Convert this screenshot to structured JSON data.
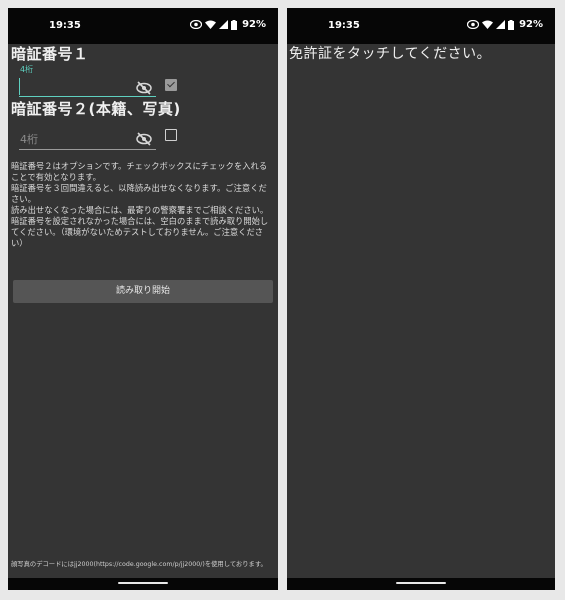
{
  "status_bar": {
    "time": "19:35",
    "battery": "92%"
  },
  "left_screen": {
    "pin1": {
      "heading": "暗証番号１",
      "floating_label": "4桁",
      "value": "",
      "checkbox_checked": true
    },
    "pin2": {
      "heading": "暗証番号２(本籍、写真)",
      "placeholder": "4桁",
      "value": "",
      "checkbox_checked": false
    },
    "notes": [
      "暗証番号２はオプションです。チェックボックスにチェックを入れることで有効となります。",
      "暗証番号を３回間違えると、以降読み出せなくなります。ご注意ください。",
      "読み出せなくなった場合には、最寄りの警察署までご相談ください。",
      "暗証番号を設定されなかった場合には、空白のままで読み取り開始してください。（環境がないためテストしておりません。ご注意ください）"
    ],
    "start_button_label": "読み取り開始",
    "footer_note": "顔写真のデコードにはjj2000(https://code.google.com/p/jj2000/)を使用しております。"
  },
  "right_screen": {
    "message": "免許証をタッチしてください。"
  },
  "colors": {
    "background": "#343434",
    "status_bar": "#060606",
    "accent": "#5fd0c0",
    "button": "#555555"
  }
}
